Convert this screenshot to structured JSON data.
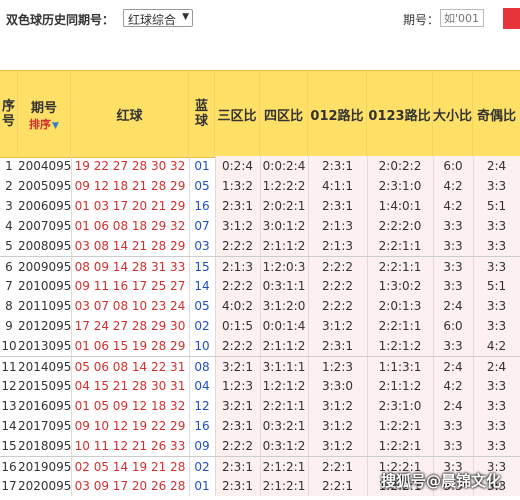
{
  "toolbar": {
    "title": "双色球历史同期号：",
    "select_value": "红球综合",
    "period_label": "期号：",
    "period_placeholder": "如'001'"
  },
  "table": {
    "headers": {
      "seq": "序号",
      "period": "期号",
      "sort": "排序",
      "red": "红球",
      "blue": "蓝球",
      "zone3": "三区比",
      "zone4": "四区比",
      "road012": "012路比",
      "road0123": "0123路比",
      "size": "大小比",
      "parity": "奇偶比"
    },
    "rows": [
      {
        "seq": "1",
        "period": "2004095",
        "red": "19 22 27 28 30 32",
        "blue": "01",
        "zone3": "0:2:4",
        "zone4": "0:0:2:4",
        "road012": "2:3:1",
        "road0123": "2:0:2:2",
        "size": "6:0",
        "parity": "2:4"
      },
      {
        "seq": "2",
        "period": "2005095",
        "red": "09 12 18 21 28 29",
        "blue": "05",
        "zone3": "1:3:2",
        "zone4": "1:2:2:2",
        "road012": "4:1:1",
        "road0123": "2:3:1:0",
        "size": "4:2",
        "parity": "3:3"
      },
      {
        "seq": "3",
        "period": "2006095",
        "red": "01 03 17 20 21 29",
        "blue": "16",
        "zone3": "2:3:1",
        "zone4": "2:0:2:1",
        "road012": "2:3:1",
        "road0123": "1:4:0:1",
        "size": "4:2",
        "parity": "5:1"
      },
      {
        "seq": "4",
        "period": "2007095",
        "red": "01 06 08 18 29 32",
        "blue": "07",
        "zone3": "3:1:2",
        "zone4": "3:0:1:2",
        "road012": "2:1:3",
        "road0123": "2:2:2:0",
        "size": "3:3",
        "parity": "3:3"
      },
      {
        "seq": "5",
        "period": "2008095",
        "red": "03 08 14 21 28 29",
        "blue": "03",
        "zone3": "2:2:2",
        "zone4": "2:1:1:2",
        "road012": "2:1:3",
        "road0123": "2:2:1:1",
        "size": "3:3",
        "parity": "3:3"
      },
      {
        "seq": "6",
        "period": "2009095",
        "red": "08 09 14 28 31 33",
        "blue": "15",
        "zone3": "2:1:3",
        "zone4": "1:2:0:3",
        "road012": "2:2:2",
        "road0123": "2:2:1:1",
        "size": "3:3",
        "parity": "3:3"
      },
      {
        "seq": "7",
        "period": "2010095",
        "red": "09 11 16 17 25 27",
        "blue": "14",
        "zone3": "2:2:2",
        "zone4": "0:3:1:1",
        "road012": "2:2:2",
        "road0123": "1:3:0:2",
        "size": "3:3",
        "parity": "5:1"
      },
      {
        "seq": "8",
        "period": "2011095",
        "red": "03 07 08 10 23 24",
        "blue": "05",
        "zone3": "4:0:2",
        "zone4": "3:1:2:0",
        "road012": "2:2:2",
        "road0123": "2:0:1:3",
        "size": "2:4",
        "parity": "3:3"
      },
      {
        "seq": "9",
        "period": "2012095",
        "red": "17 24 27 28 29 30",
        "blue": "02",
        "zone3": "0:1:5",
        "zone4": "0:0:1:4",
        "road012": "3:1:2",
        "road0123": "2:2:1:1",
        "size": "6:0",
        "parity": "3:3"
      },
      {
        "seq": "10",
        "period": "2013095",
        "red": "01 06 15 19 28 29",
        "blue": "10",
        "zone3": "2:2:2",
        "zone4": "2:1:1:2",
        "road012": "2:3:1",
        "road0123": "1:2:1:2",
        "size": "3:3",
        "parity": "4:2"
      },
      {
        "seq": "11",
        "period": "2014095",
        "red": "05 06 08 14 22 31",
        "blue": "08",
        "zone3": "3:2:1",
        "zone4": "3:1:1:1",
        "road012": "1:2:3",
        "road0123": "1:1:3:1",
        "size": "2:4",
        "parity": "2:4"
      },
      {
        "seq": "12",
        "period": "2015095",
        "red": "04 15 21 28 30 31",
        "blue": "04",
        "zone3": "1:2:3",
        "zone4": "1:2:1:2",
        "road012": "3:3:0",
        "road0123": "2:1:1:2",
        "size": "4:2",
        "parity": "3:3"
      },
      {
        "seq": "13",
        "period": "2016095",
        "red": "01 05 09 12 18 32",
        "blue": "12",
        "zone3": "3:2:1",
        "zone4": "2:2:1:1",
        "road012": "3:1:2",
        "road0123": "2:3:1:0",
        "size": "2:4",
        "parity": "3:3"
      },
      {
        "seq": "14",
        "period": "2017095",
        "red": "09 10 12 19 22 29",
        "blue": "16",
        "zone3": "2:3:1",
        "zone4": "0:3:2:1",
        "road012": "3:1:2",
        "road0123": "1:2:2:1",
        "size": "3:3",
        "parity": "3:3"
      },
      {
        "seq": "15",
        "period": "2018095",
        "red": "10 11 12 21 26 33",
        "blue": "09",
        "zone3": "2:2:2",
        "zone4": "0:3:1:2",
        "road012": "3:1:2",
        "road0123": "1:2:2:1",
        "size": "3:3",
        "parity": "3:3"
      },
      {
        "seq": "16",
        "period": "2019095",
        "red": "02 05 14 19 21 28",
        "blue": "02",
        "zone3": "2:3:1",
        "zone4": "2:1:2:1",
        "road012": "2:2:1",
        "road0123": "1:2:2:1",
        "size": "3:3",
        "parity": "3:3"
      },
      {
        "seq": "17",
        "period": "2020095",
        "red": "03 09 17 20 26 28",
        "blue": "01",
        "zone3": "2:3:1",
        "zone4": "2:1:2:1",
        "road012": "2:2:1",
        "road0123": "1:2:2:1",
        "size": "3:3",
        "parity": "3:3"
      }
    ]
  },
  "watermark": "搜狐号@晨锦文化",
  "colors": {
    "header_bg": "#ffe066",
    "red_ball": "#d42f2f",
    "blue_ball": "#1f4fc4",
    "accent": "#e6353a"
  }
}
